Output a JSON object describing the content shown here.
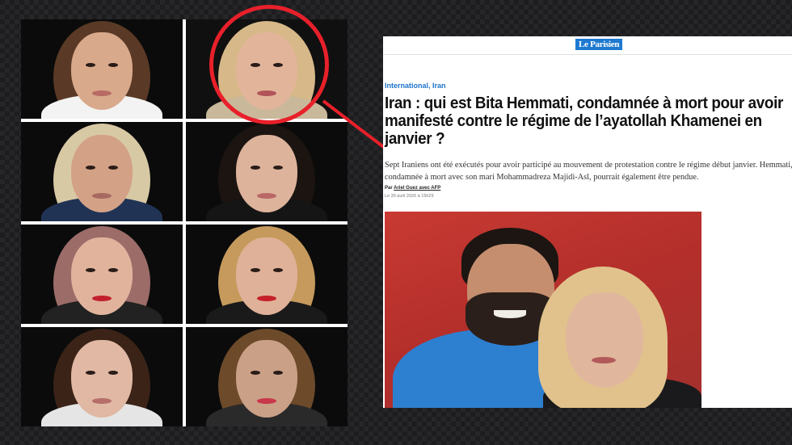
{
  "portraits": [
    {
      "name": "portrait-1",
      "hair": "#5a3a26",
      "skin": "#d9a98b",
      "bg": "#0b0b0b",
      "lip": "#b86b65",
      "top": "#f3f3f3"
    },
    {
      "name": "portrait-2",
      "hair": "#d7b888",
      "skin": "#e2b59a",
      "bg": "#101010",
      "lip": "#b2555a",
      "top": "#c9b89a"
    },
    {
      "name": "portrait-3",
      "hair": "#d8c9a5",
      "skin": "#d3a286",
      "bg": "#0b0b0b",
      "lip": "#a86862",
      "top": "#203355"
    },
    {
      "name": "portrait-4",
      "hair": "#1c1410",
      "skin": "#ddb39c",
      "bg": "#0b0b0b",
      "lip": "#b96866",
      "top": "#151515"
    },
    {
      "name": "portrait-5",
      "hair": "#9c6c69",
      "skin": "#e1b39d",
      "bg": "#0b0b0b",
      "lip": "#c1202c",
      "top": "#222222"
    },
    {
      "name": "portrait-6",
      "hair": "#c59a5c",
      "skin": "#dfb198",
      "bg": "#0b0b0b",
      "lip": "#c5202a",
      "top": "#1a1a1a"
    },
    {
      "name": "portrait-7",
      "hair": "#3b2317",
      "skin": "#e0b8a3",
      "bg": "#0b0b0b",
      "lip": "#b66e6b",
      "top": "#e5e5e5"
    },
    {
      "name": "portrait-8",
      "hair": "#6d4a2a",
      "skin": "#caa087",
      "bg": "#0b0b0b",
      "lip": "#c8374a",
      "top": "#2a2a2a"
    }
  ],
  "highlight_color": "#e8202a",
  "article": {
    "logo": "Le Parisien",
    "category": "International, Iran",
    "headline": "Iran : qui est Bita Hemmati, condamnée à mort pour avoir manifesté contre le régime de l’ayatollah Khamenei en janvier ?",
    "dek": "Sept Iraniens ont été exécutés pour avoir participé au mouvement de protestation contre le régime début janvier. Hemmati, condamnée à mort avec son mari Mohammadreza Majidi-Asl, pourrait également être pendue.",
    "byline_prefix": "Par",
    "byline_author": "Ariel Guez avec AFP",
    "date": "Le 30 avril 2026 à 15h29"
  }
}
